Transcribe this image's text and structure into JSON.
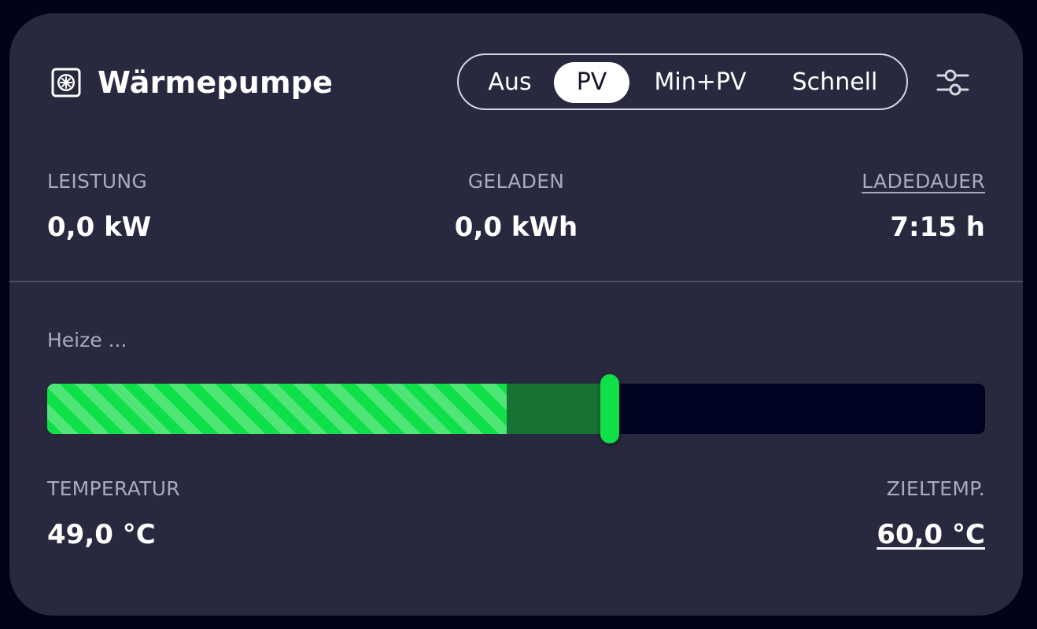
{
  "header": {
    "title": "Wärmepumpe",
    "device_icon": "heatpump-icon",
    "settings_icon": "sliders-icon"
  },
  "modes": {
    "items": [
      "Aus",
      "PV",
      "Min+PV",
      "Schnell"
    ],
    "active": "PV"
  },
  "stats": {
    "power_label": "LEISTUNG",
    "power_value": "0,0 kW",
    "charged_label": "GELADEN",
    "charged_value": "0,0 kWh",
    "duration_label": "LADEDAUER",
    "duration_value": "7:15 h"
  },
  "status": {
    "text": "Heize ..."
  },
  "progress": {
    "current_percent": 49,
    "target_percent": 60
  },
  "temperature": {
    "current_label": "TEMPERATUR",
    "current_value": "49,0 °C",
    "target_label": "ZIELTEMP.",
    "target_value": "60,0 °C"
  },
  "colors": {
    "background": "#020319",
    "card": "#28293e",
    "accent_green": "#0fe04a",
    "target_green": "#177334",
    "track": "#000321"
  }
}
